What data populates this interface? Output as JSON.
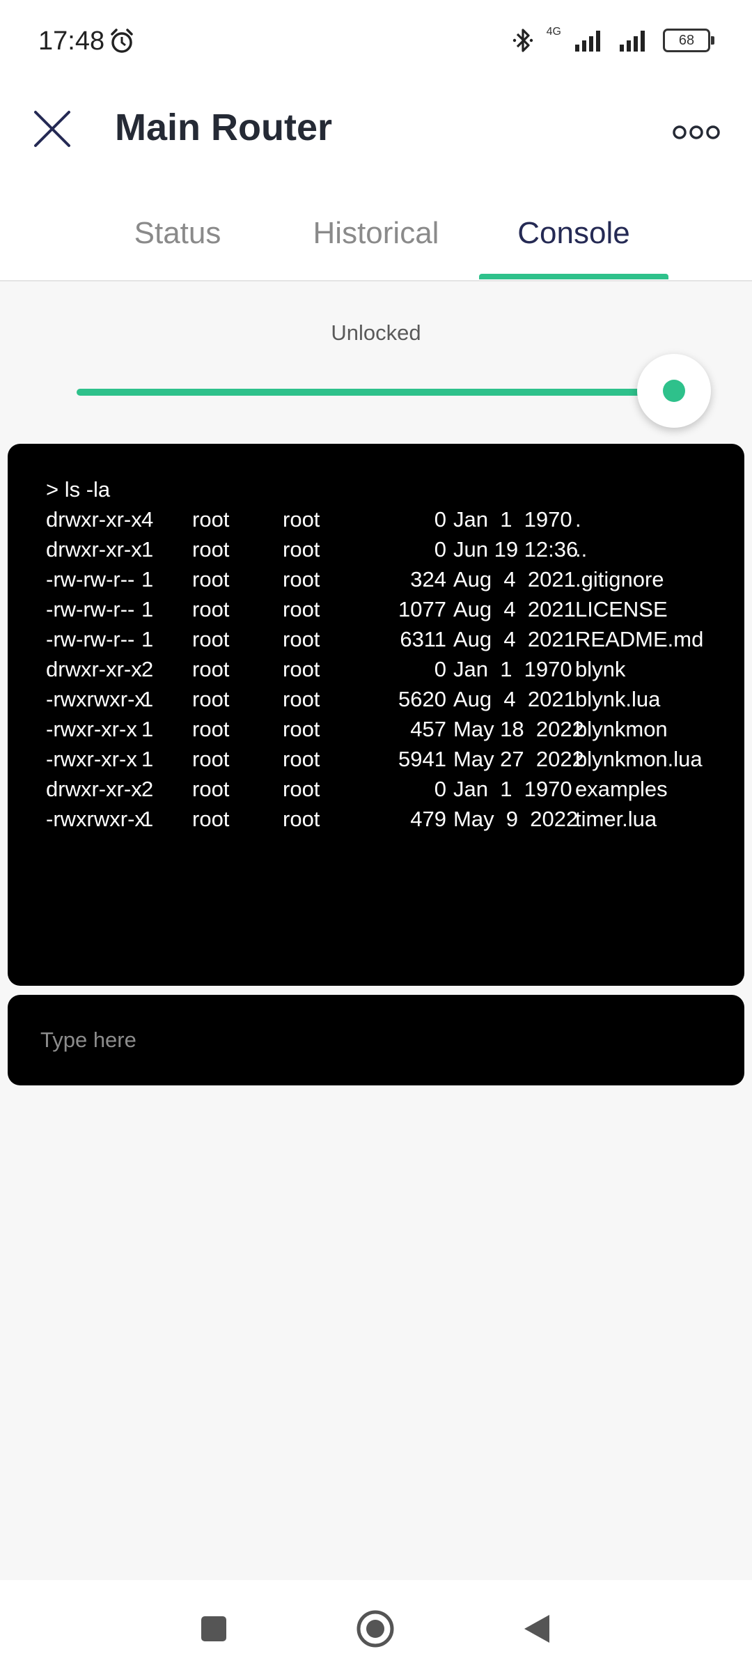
{
  "status_bar": {
    "time": "17:48",
    "network_label": "4G",
    "battery": "68",
    "icons": [
      "alarm-icon",
      "bluetooth-icon",
      "signal-icon",
      "signal-icon",
      "battery-icon"
    ]
  },
  "header": {
    "title": "Main Router",
    "close_icon": "close-icon",
    "more_icon": "more-icon"
  },
  "tabs": [
    {
      "label": "Status",
      "active": false
    },
    {
      "label": "Historical",
      "active": false
    },
    {
      "label": "Console",
      "active": true
    }
  ],
  "lock_slider": {
    "label": "Unlocked",
    "level": 1.0,
    "color": "#2ec18b"
  },
  "terminal": {
    "command": "> ls -la",
    "entries": [
      {
        "perm": "drwxr-xr-x",
        "links": "4",
        "owner": "root",
        "group": "root",
        "size": "0",
        "date": "Jan  1  1970",
        "name": "."
      },
      {
        "perm": "drwxr-xr-x",
        "links": "1",
        "owner": "root",
        "group": "root",
        "size": "0",
        "date": "Jun 19 12:36",
        "name": ".."
      },
      {
        "perm": "-rw-rw-r--",
        "links": "1",
        "owner": "root",
        "group": "root",
        "size": "324",
        "date": "Aug  4  2021",
        "name": ".gitignore"
      },
      {
        "perm": "-rw-rw-r--",
        "links": "1",
        "owner": "root",
        "group": "root",
        "size": "1077",
        "date": "Aug  4  2021",
        "name": "LICENSE"
      },
      {
        "perm": "-rw-rw-r--",
        "links": "1",
        "owner": "root",
        "group": "root",
        "size": "6311",
        "date": "Aug  4  2021",
        "name": "README.md"
      },
      {
        "perm": "drwxr-xr-x",
        "links": "2",
        "owner": "root",
        "group": "root",
        "size": "0",
        "date": "Jan  1  1970",
        "name": "blynk"
      },
      {
        "perm": "-rwxrwxr-x",
        "links": "1",
        "owner": "root",
        "group": "root",
        "size": "5620",
        "date": "Aug  4  2021",
        "name": "blynk.lua"
      },
      {
        "perm": "-rwxr-xr-x",
        "links": "1",
        "owner": "root",
        "group": "root",
        "size": "457",
        "date": "May 18  2022",
        "name": "blynkmon"
      },
      {
        "perm": "-rwxr-xr-x",
        "links": "1",
        "owner": "root",
        "group": "root",
        "size": "5941",
        "date": "May 27  2022",
        "name": "blynkmon.lua"
      },
      {
        "perm": "drwxr-xr-x",
        "links": "2",
        "owner": "root",
        "group": "root",
        "size": "0",
        "date": "Jan  1  1970",
        "name": "examples"
      },
      {
        "perm": "-rwxrwxr-x",
        "links": "1",
        "owner": "root",
        "group": "root",
        "size": "479",
        "date": "May  9  2022",
        "name": "timer.lua"
      }
    ],
    "input_placeholder": "Type here",
    "input_value": ""
  },
  "nav_bar": {
    "icons": [
      "recents-icon",
      "home-icon",
      "back-icon"
    ]
  },
  "colors": {
    "accent": "#2ec18b",
    "title": "#252a35",
    "terminal_bg": "#000000"
  }
}
